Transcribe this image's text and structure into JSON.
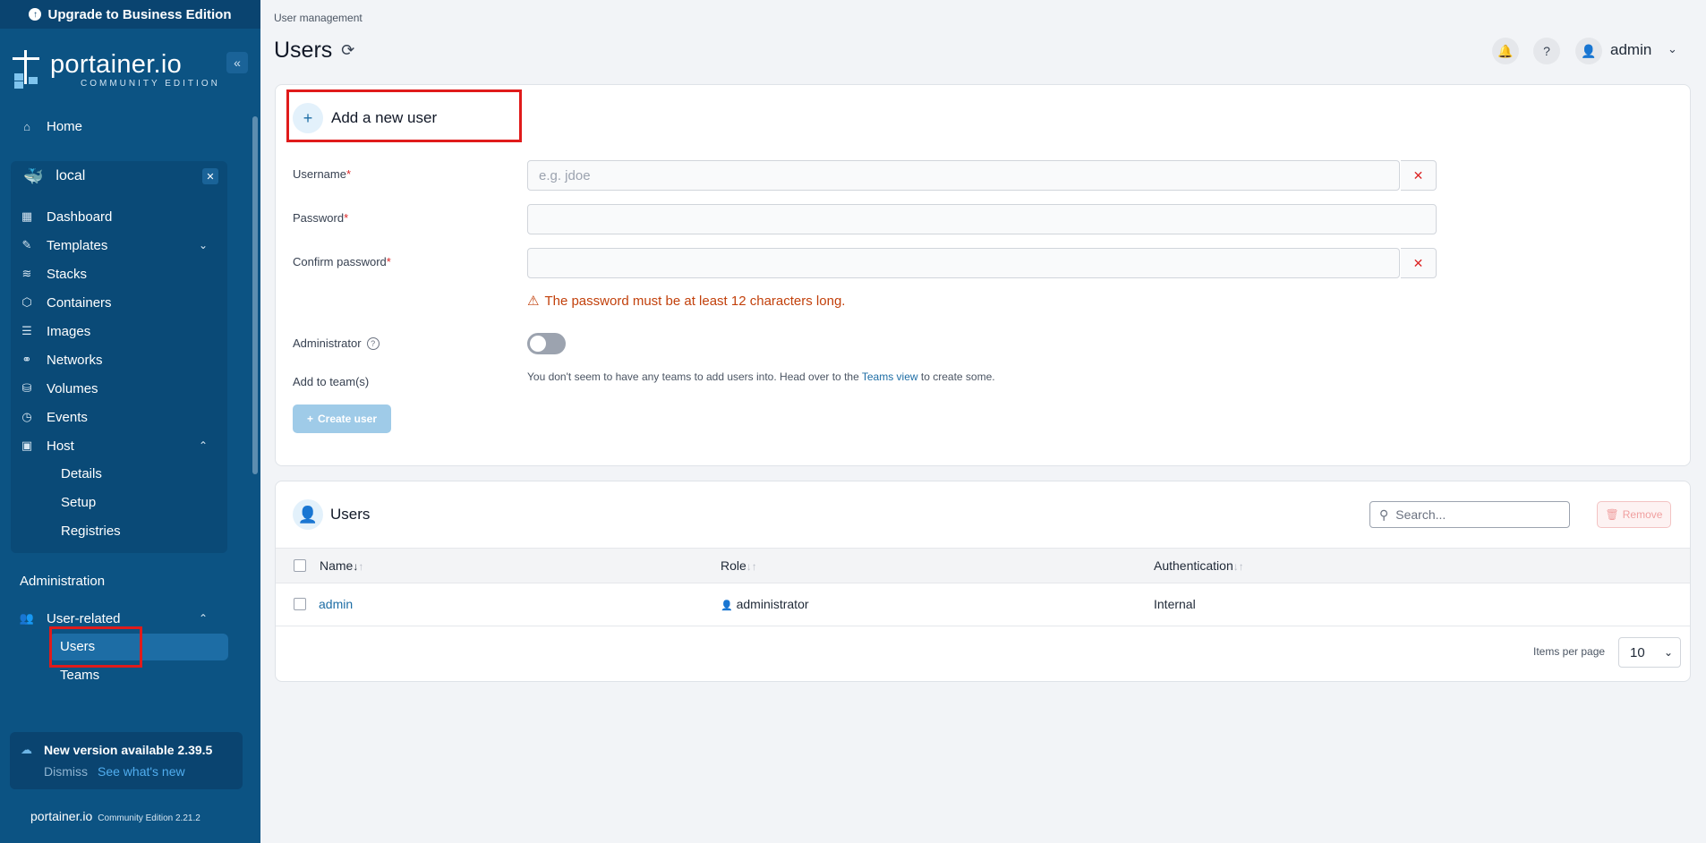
{
  "sidebar": {
    "upgrade_label": "Upgrade to Business Edition",
    "logo": "portainer.io",
    "logo_edition": "COMMUNITY EDITION",
    "home": "Home",
    "environment": {
      "name": "local",
      "items": [
        "Dashboard",
        "Templates",
        "Stacks",
        "Containers",
        "Images",
        "Networks",
        "Volumes",
        "Events",
        "Host"
      ],
      "host_sub": [
        "Details",
        "Setup",
        "Registries"
      ]
    },
    "admin_heading": "Administration",
    "user_related": "User-related",
    "user_sub": [
      "Users",
      "Teams"
    ],
    "update": {
      "title": "New version available 2.39.5",
      "dismiss": "Dismiss",
      "link": "See what's new"
    },
    "footer_brand": "portainer.io",
    "footer_edition": "Community Edition 2.21.2"
  },
  "header": {
    "breadcrumb": "User management",
    "title": "Users",
    "user": "admin"
  },
  "form": {
    "title": "Add a new user",
    "username_label": "Username",
    "username_placeholder": "e.g. jdoe",
    "password_label": "Password",
    "confirm_label": "Confirm password",
    "required_mark": "*",
    "warning": "The password must be at least 12 characters long.",
    "admin_label": "Administrator",
    "admin_enabled": false,
    "teams_label": "Add to team(s)",
    "teams_text_before": "You don't seem to have any teams to add users into. Head over to the",
    "teams_link": "Teams view",
    "teams_text_after": "to create some.",
    "create_button": "Create user"
  },
  "users_table": {
    "title": "Users",
    "search_placeholder": "Search...",
    "remove_button": "Remove",
    "columns": [
      "Name",
      "Role",
      "Authentication"
    ],
    "rows": [
      {
        "name": "admin",
        "role": "administrator",
        "auth": "Internal"
      }
    ],
    "items_per_page_label": "Items per page",
    "items_per_page": "10"
  }
}
